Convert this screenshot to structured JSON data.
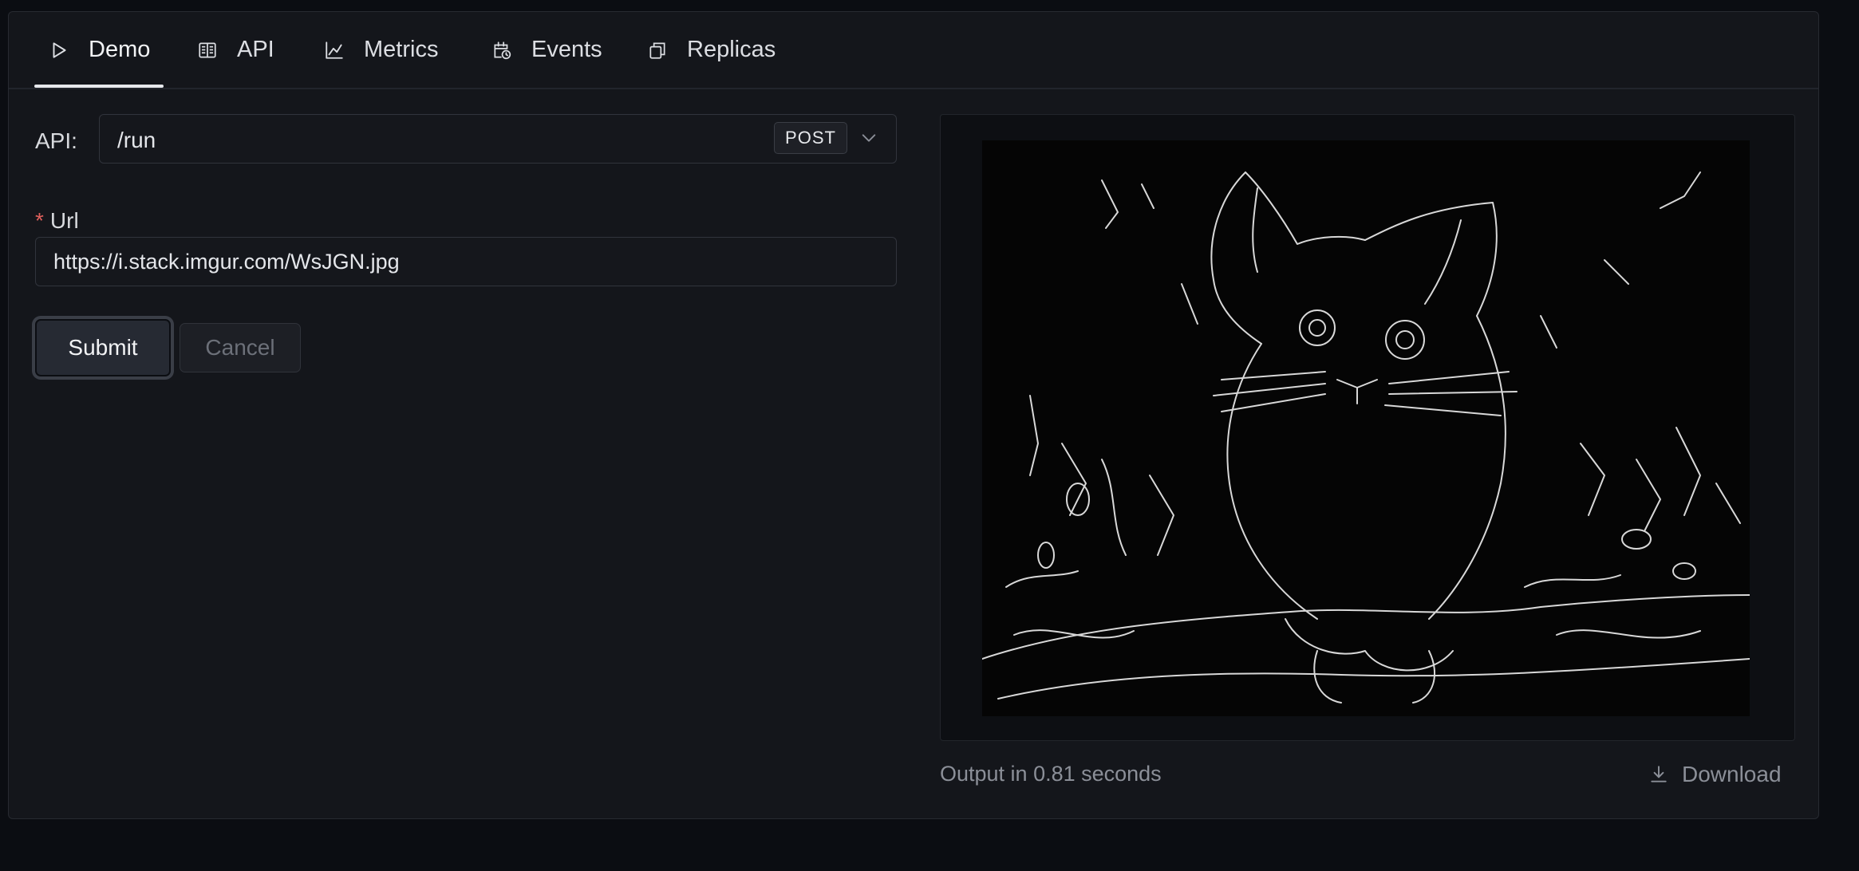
{
  "tabs": [
    {
      "label": "Demo",
      "icon": "play-icon",
      "active": true
    },
    {
      "label": "API",
      "icon": "api-doc-icon"
    },
    {
      "label": "Metrics",
      "icon": "line-chart-icon"
    },
    {
      "label": "Events",
      "icon": "calendar-clock-icon"
    },
    {
      "label": "Replicas",
      "icon": "copy-icon"
    }
  ],
  "api": {
    "label": "API:",
    "path": "/run",
    "method": "POST"
  },
  "form": {
    "url_label": "Url",
    "required_marker": "*",
    "url_value": "https://i.stack.imgur.com/WsJGN.jpg",
    "submit_label": "Submit",
    "cancel_label": "Cancel"
  },
  "output": {
    "time_text": "Output in 0.81 seconds",
    "download_label": "Download"
  },
  "colors": {
    "background": "#0b0d12",
    "panel": "#14161b",
    "accent_required": "#e0605c"
  }
}
